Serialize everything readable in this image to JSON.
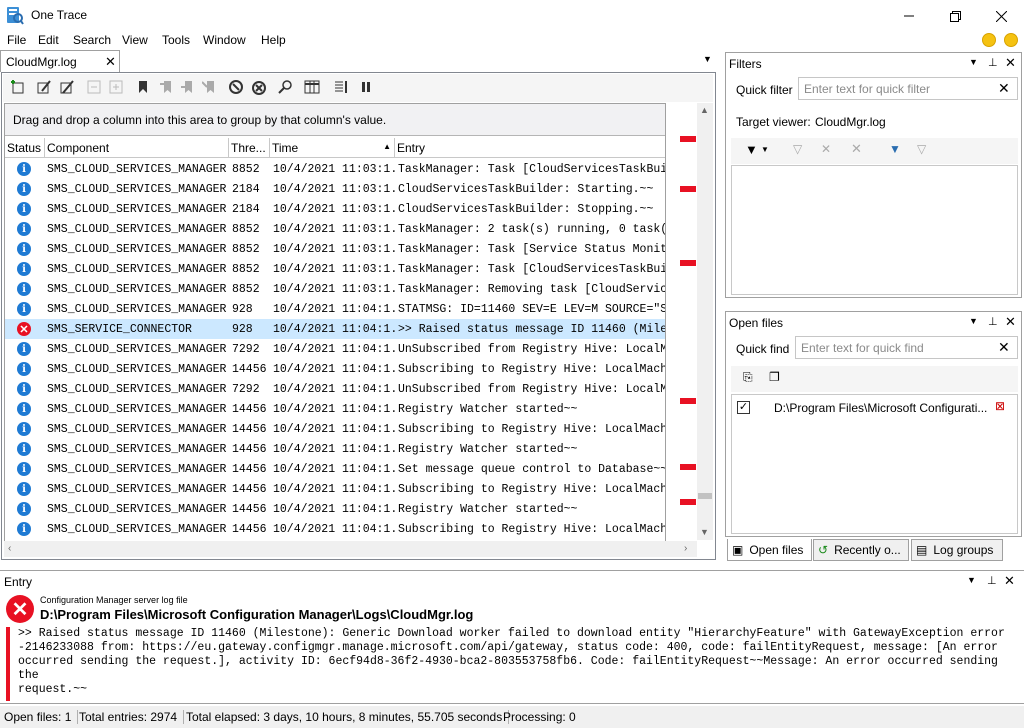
{
  "window": {
    "title": "One Trace"
  },
  "menu": [
    "File",
    "Edit",
    "Search",
    "View",
    "Tools",
    "Window",
    "Help"
  ],
  "document_tab": {
    "label": "CloudMgr.log"
  },
  "grid": {
    "group_hint": "Drag and drop a column into this area to group by that column's value.",
    "columns": {
      "status": "Status",
      "component": "Component",
      "thread": "Thre...",
      "time": "Time",
      "entry": "Entry"
    },
    "rows": [
      {
        "status": "info",
        "component": "SMS_CLOUD_SERVICES_MANAGER",
        "thread": "8852",
        "time": "10/4/2021 11:03:1...",
        "entry": "TaskManager: Task [CloudServicesTaskBui..."
      },
      {
        "status": "info",
        "component": "SMS_CLOUD_SERVICES_MANAGER",
        "thread": "2184",
        "time": "10/4/2021 11:03:1...",
        "entry": "CloudServicesTaskBuilder: Starting.~~"
      },
      {
        "status": "info",
        "component": "SMS_CLOUD_SERVICES_MANAGER",
        "thread": "2184",
        "time": "10/4/2021 11:03:1...",
        "entry": "CloudServicesTaskBuilder: Stopping.~~"
      },
      {
        "status": "info",
        "component": "SMS_CLOUD_SERVICES_MANAGER",
        "thread": "8852",
        "time": "10/4/2021 11:03:1...",
        "entry": "TaskManager: 2 task(s) running, 0 task(..."
      },
      {
        "status": "info",
        "component": "SMS_CLOUD_SERVICES_MANAGER",
        "thread": "8852",
        "time": "10/4/2021 11:03:1...",
        "entry": "TaskManager: Task [Service Status Monit..."
      },
      {
        "status": "info",
        "component": "SMS_CLOUD_SERVICES_MANAGER",
        "thread": "8852",
        "time": "10/4/2021 11:03:1...",
        "entry": "TaskManager: Task [CloudServicesTaskBui..."
      },
      {
        "status": "info",
        "component": "SMS_CLOUD_SERVICES_MANAGER",
        "thread": "8852",
        "time": "10/4/2021 11:03:1...",
        "entry": "TaskManager: Removing task [CloudServic..."
      },
      {
        "status": "info",
        "component": "SMS_CLOUD_SERVICES_MANAGER",
        "thread": "928",
        "time": "10/4/2021 11:04:1...",
        "entry": "STATMSG: ID=11460 SEV=E LEV=M SOURCE=\"S..."
      },
      {
        "status": "error",
        "component": "SMS_SERVICE_CONNECTOR",
        "thread": "928",
        "time": "10/4/2021 11:04:1...",
        "entry": ">> Raised status message ID 11460 (Mile...",
        "selected": true
      },
      {
        "status": "info",
        "component": "SMS_CLOUD_SERVICES_MANAGER",
        "thread": "7292",
        "time": "10/4/2021 11:04:1...",
        "entry": "UnSubscribed from Registry Hive: LocalM..."
      },
      {
        "status": "info",
        "component": "SMS_CLOUD_SERVICES_MANAGER",
        "thread": "14456",
        "time": "10/4/2021 11:04:1...",
        "entry": "Subscribing to Registry Hive: LocalMach..."
      },
      {
        "status": "info",
        "component": "SMS_CLOUD_SERVICES_MANAGER",
        "thread": "7292",
        "time": "10/4/2021 11:04:1...",
        "entry": "UnSubscribed from Registry Hive: LocalM..."
      },
      {
        "status": "info",
        "component": "SMS_CLOUD_SERVICES_MANAGER",
        "thread": "14456",
        "time": "10/4/2021 11:04:1...",
        "entry": "Registry Watcher started~~"
      },
      {
        "status": "info",
        "component": "SMS_CLOUD_SERVICES_MANAGER",
        "thread": "14456",
        "time": "10/4/2021 11:04:1...",
        "entry": "Subscribing to Registry Hive: LocalMach..."
      },
      {
        "status": "info",
        "component": "SMS_CLOUD_SERVICES_MANAGER",
        "thread": "14456",
        "time": "10/4/2021 11:04:1...",
        "entry": "Registry Watcher started~~"
      },
      {
        "status": "info",
        "component": "SMS_CLOUD_SERVICES_MANAGER",
        "thread": "14456",
        "time": "10/4/2021 11:04:1...",
        "entry": "Set message queue control to Database~~"
      },
      {
        "status": "info",
        "component": "SMS_CLOUD_SERVICES_MANAGER",
        "thread": "14456",
        "time": "10/4/2021 11:04:1...",
        "entry": "Subscribing to Registry Hive: LocalMach..."
      },
      {
        "status": "info",
        "component": "SMS_CLOUD_SERVICES_MANAGER",
        "thread": "14456",
        "time": "10/4/2021 11:04:1...",
        "entry": "Registry Watcher started~~"
      },
      {
        "status": "info",
        "component": "SMS_CLOUD_SERVICES_MANAGER",
        "thread": "14456",
        "time": "10/4/2021 11:04:1...",
        "entry": "Subscribing to Registry Hive: LocalMach..."
      }
    ]
  },
  "filters": {
    "title": "Filters",
    "quick_filter_label": "Quick filter",
    "quick_filter_placeholder": "Enter text for quick filter",
    "target_viewer_label": "Target viewer:",
    "target_viewer_value": "CloudMgr.log"
  },
  "open_files": {
    "title": "Open files",
    "quick_find_label": "Quick find",
    "quick_find_placeholder": "Enter text for quick find",
    "file_path": "D:\\Program Files\\Microsoft Configurati..."
  },
  "side_tabs": {
    "open_files": "Open files",
    "recently": "Recently o...",
    "log_groups": "Log groups"
  },
  "entry_pane": {
    "title": "Entry",
    "subtitle": "Configuration Manager server log file",
    "path": "D:\\Program Files\\Microsoft Configuration Manager\\Logs\\CloudMgr.log",
    "lines": [
      ">> Raised status message ID 11460 (Milestone): Generic Download worker failed to download entity \"HierarchyFeature\" with GatewayException error",
      "-2146233088 from: https://eu.gateway.configmgr.manage.microsoft.com/api/gateway, status code: 400, code: failEntityRequest, message: [An error",
      "occurred sending the request.], activity ID: 6ecf94d8-36f2-4930-bca2-803553758fb6. Code: failEntityRequest~~Message: An error occurred sending the",
      "request.~~"
    ]
  },
  "status_bar": {
    "open_files": "Open files: 1",
    "total_entries": "Total entries: 2974",
    "elapsed": "Total elapsed: 3 days, 10 hours, 8 minutes, 55.705 seconds",
    "processing": "Processing: 0"
  },
  "colors": {
    "error": "#e81123",
    "info": "#1e7ad3",
    "selected_row": "#cce8ff",
    "overview_mark": "#e81123"
  }
}
